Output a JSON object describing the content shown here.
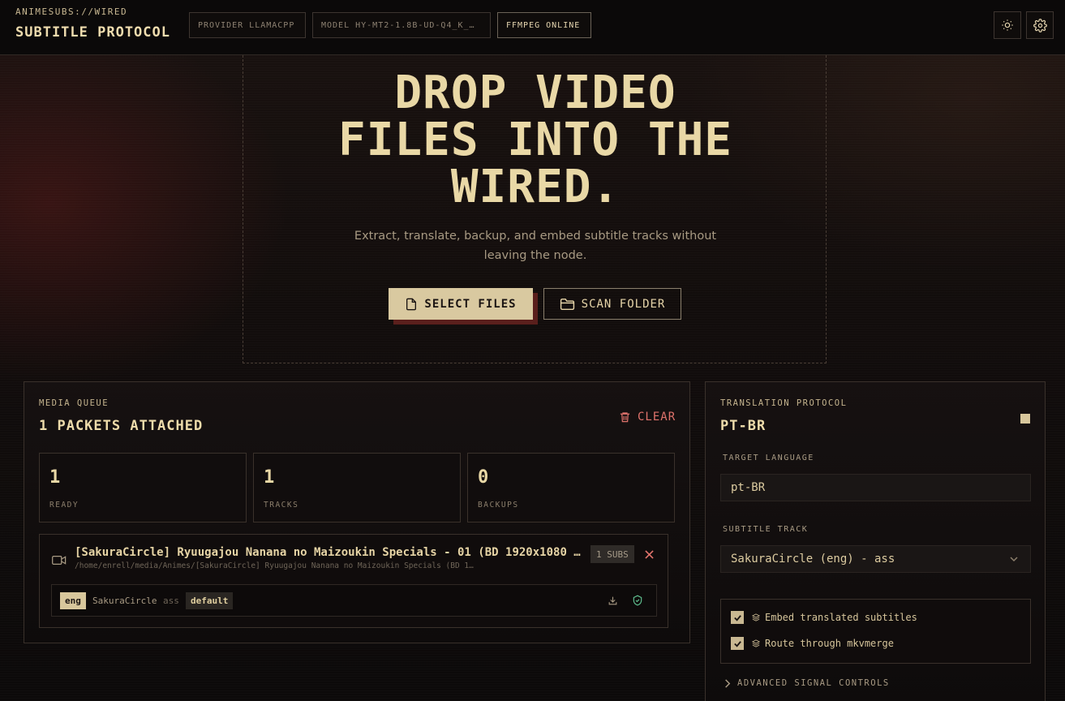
{
  "header": {
    "brand_sub": "ANIMESUBS://WIRED",
    "brand_title": "SUBTITLE PROTOCOL",
    "chips": {
      "provider": "PROVIDER LLAMACPP",
      "model": "MODEL HY-MT2-1.8B-UD-Q4_K_…",
      "ffmpeg": "FFMPEG ONLINE"
    },
    "icons": [
      "sun-icon",
      "gear-icon"
    ]
  },
  "dropzone": {
    "title_line1": "DROP VIDEO",
    "title_line2": "FILES INTO THE",
    "title_line3": "WIRED.",
    "description": "Extract, translate, backup, and embed subtitle tracks without leaving the node.",
    "select_label": "SELECT FILES",
    "scan_label": "SCAN FOLDER"
  },
  "queue": {
    "label": "MEDIA QUEUE",
    "title": "1 PACKETS ATTACHED",
    "clear_label": "CLEAR",
    "stats": [
      {
        "value": "1",
        "label": "READY"
      },
      {
        "value": "1",
        "label": "TRACKS"
      },
      {
        "value": "0",
        "label": "BACKUPS"
      }
    ],
    "file": {
      "name": "[SakuraCircle] Ryuugajou Nanana no Maizoukin Specials - 01 (BD 1920x1080 …",
      "path": "/home/enrell/media/Animes/[SakuraCircle] Ryuugajou Nanana no Maizoukin Specials (BD 1…",
      "subs_badge": "1 SUBS",
      "track": {
        "lang": "eng",
        "source": "SakuraCircle",
        "format": "ass",
        "flag": "default"
      }
    }
  },
  "translation": {
    "label": "TRANSLATION PROTOCOL",
    "title": "PT-BR",
    "target_label": "TARGET LANGUAGE",
    "target_value": "pt-BR",
    "track_label": "SUBTITLE TRACK",
    "track_value": "SakuraCircle (eng) - ass",
    "options": [
      {
        "label": "Embed translated subtitles",
        "checked": true
      },
      {
        "label": "Route through mkvmerge",
        "checked": true
      }
    ],
    "advanced_label": "ADVANCED SIGNAL CONTROLS"
  },
  "colors": {
    "accent": "#d9c9a0",
    "danger": "#e0736c",
    "shadow_red": "#5a1f1c",
    "background": "#0d0b0b"
  }
}
